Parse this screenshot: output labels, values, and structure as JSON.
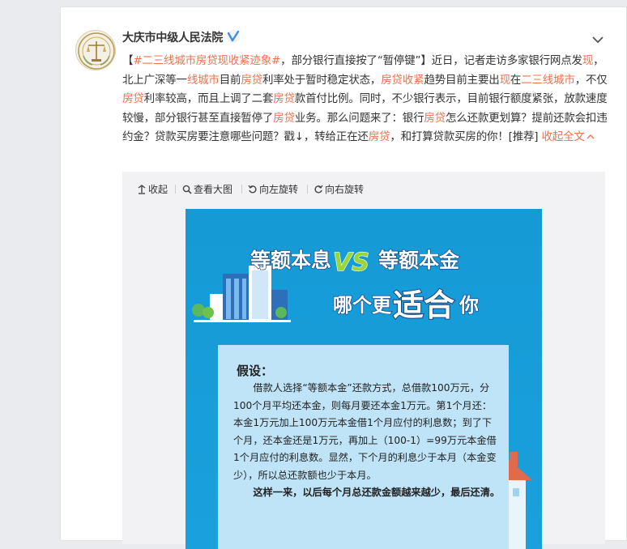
{
  "post": {
    "author": "大庆市中级人民法院",
    "text": {
      "t1": "【",
      "topic": "#二三线城市房贷现收紧迹象#",
      "t2": "，部分银行直接按了“暂停键”】近日，记者走访多家银行网点发",
      "t3": "现",
      "t4": "，北上广深等一",
      "t5": "线城市",
      "t6": "目前",
      "t7": "房贷",
      "t8": "利率处于暂时稳定状态，",
      "t9": "房贷收紧",
      "t10": "趋势目前主要出",
      "t11": "现",
      "t12": "在",
      "t13": "二三线城市",
      "t14": "，不仅",
      "t15": "房贷",
      "t16": "利率较高，而且上调了二套",
      "t17": "房贷",
      "t18": "款首付比例。同时，不少银行表示，目前银行额度紧张，放款速度较慢，部分银行甚至直接暂停了",
      "t19": "房贷",
      "t20": "业务。那么问题来了：银行",
      "t21": "房贷",
      "t22": "怎么还款更划算？提前还款会扣违约金？贷款买房要注意哪些问题？戳↓，转给正在还",
      "t23": "房贷",
      "t24": "，和打算贷款买房的你！[推荐]",
      "expand": "收起全文"
    }
  },
  "toolbar": {
    "collapse": "收起",
    "view_large": "查看大图",
    "rotate_left": "向左旋转",
    "rotate_right": "向右旋转"
  },
  "poster": {
    "title_left": "等额本息",
    "vs": "VS",
    "title_right": "等额本金",
    "sub_a": "哪个更",
    "sub_b": "适合",
    "sub_c": "你",
    "panel_title": "假设：",
    "p1": "借款人选择“等额本金”还款方式，总借款100万元，分100个月平均还本金，则每月要还本金1万元。第1个月还：本金1万元加上100万元本金借1个月应付的利息数；到了下个月，还本金还是1万元，再加上（100-1）=99万元本金借1个月应付的利息数。显然，下个月的利息少于本月（本金变少），所以总还款额也少于本月。",
    "p2": "这样一来，以后每个月总还款金额越来越少，最后还清。"
  },
  "colors": {
    "link": "#eb7350",
    "poster_bg": "#159ad6",
    "panel_bg": "#bfe3f7",
    "accent_green": "#9ad63a"
  },
  "icons": [
    "court-emblem-avatar",
    "verified-badge-icon",
    "chevron-down-icon",
    "collapse-icon",
    "magnifier-icon",
    "rotate-left-icon",
    "rotate-right-icon"
  ]
}
